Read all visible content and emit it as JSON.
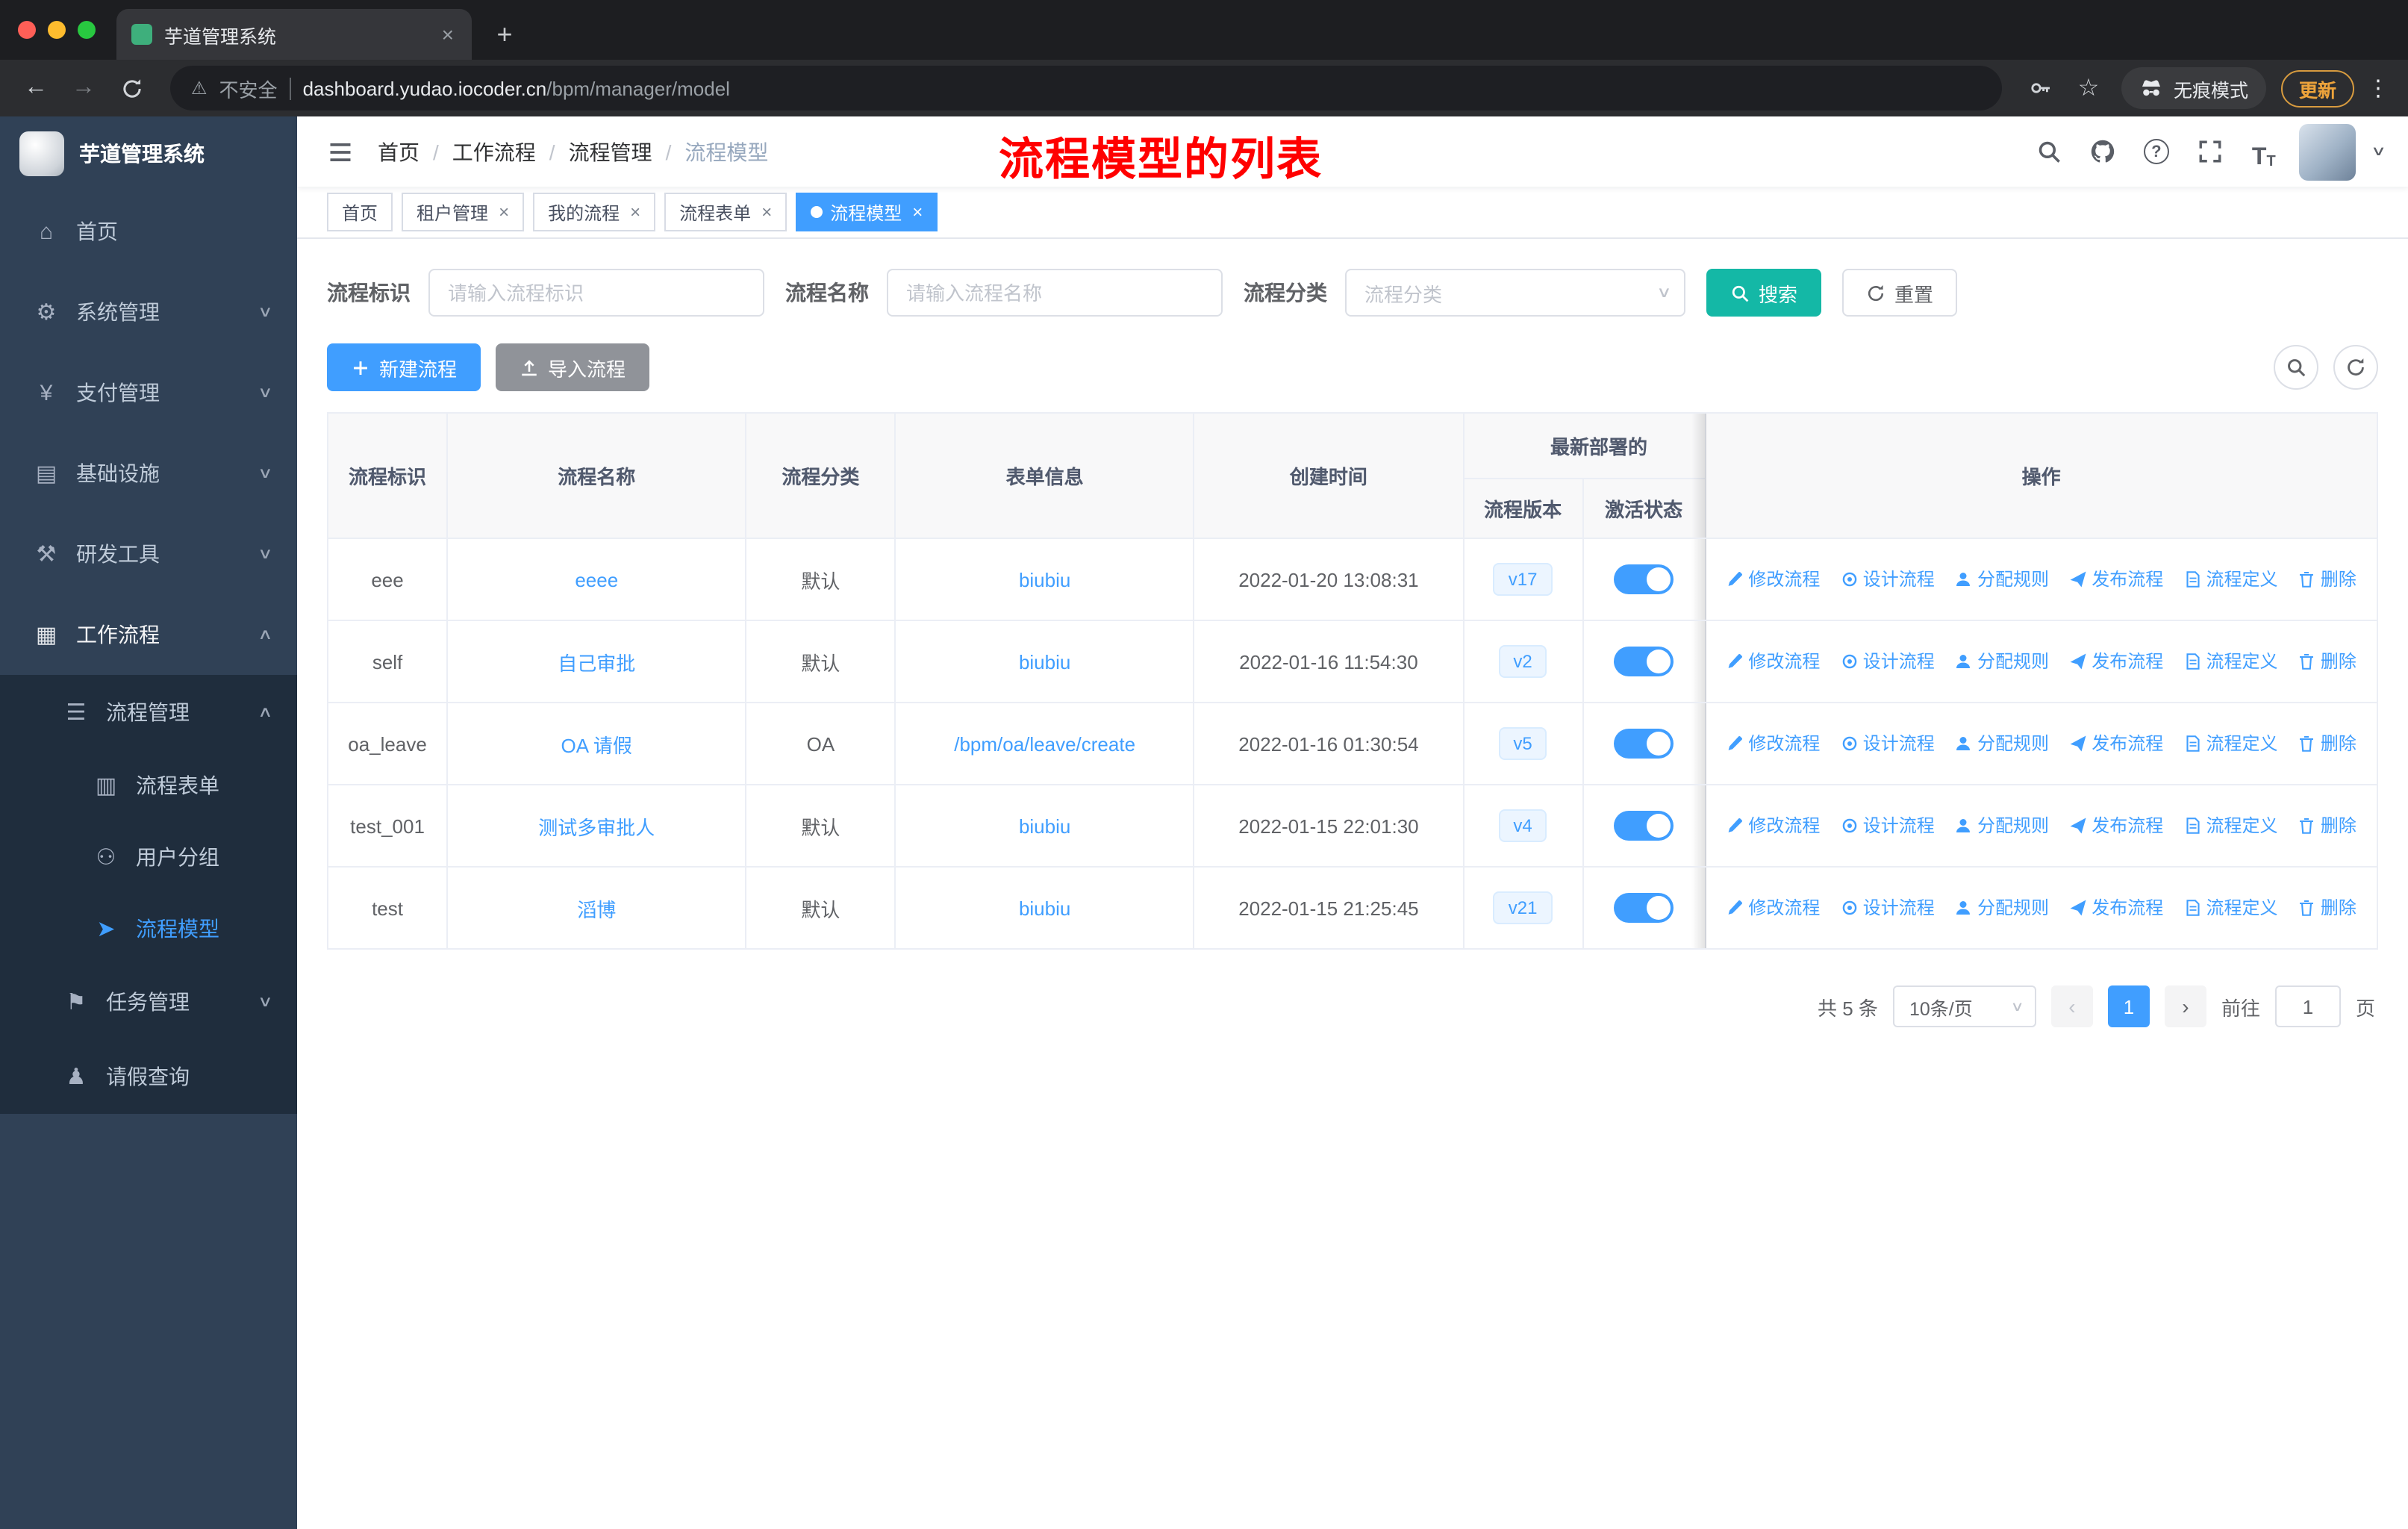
{
  "colors": {
    "accent": "#409eff",
    "search_button": "#14b8a6",
    "annotation_red": "#ff0000",
    "sidebar_bg": "#304156",
    "submenu_bg": "#1f2d3d",
    "active_toggle": "#409eff"
  },
  "browser": {
    "tab_title": "芋道管理系统",
    "security_label": "不安全",
    "url_domain": "dashboard.yudao.iocoder.cn",
    "url_path": "/bpm/manager/model",
    "incognito_label": "无痕模式",
    "update_label": "更新"
  },
  "sidebar": {
    "logo_title": "芋道管理系统",
    "items": [
      {
        "label": "首页"
      },
      {
        "label": "系统管理"
      },
      {
        "label": "支付管理"
      },
      {
        "label": "基础设施"
      },
      {
        "label": "研发工具"
      },
      {
        "label": "工作流程"
      },
      {
        "label": "流程管理"
      },
      {
        "label": "流程表单"
      },
      {
        "label": "用户分组"
      },
      {
        "label": "流程模型"
      },
      {
        "label": "任务管理"
      },
      {
        "label": "请假查询"
      }
    ]
  },
  "header": {
    "breadcrumb": [
      "首页",
      "工作流程",
      "流程管理",
      "流程模型"
    ],
    "annotation": "流程模型的列表"
  },
  "tags": [
    {
      "label": "首页"
    },
    {
      "label": "租户管理"
    },
    {
      "label": "我的流程"
    },
    {
      "label": "流程表单"
    },
    {
      "label": "流程模型"
    }
  ],
  "filters": {
    "key_label": "流程标识",
    "key_placeholder": "请输入流程标识",
    "name_label": "流程名称",
    "name_placeholder": "请输入流程名称",
    "category_label": "流程分类",
    "category_placeholder": "流程分类",
    "search_label": "搜索",
    "reset_label": "重置"
  },
  "toolbar": {
    "create_label": "新建流程",
    "import_label": "导入流程"
  },
  "table": {
    "headers": {
      "key": "流程标识",
      "name": "流程名称",
      "category": "流程分类",
      "form": "表单信息",
      "created": "创建时间",
      "deploy_group": "最新部署的",
      "version": "流程版本",
      "active": "激活状态",
      "actions": "操作"
    },
    "action_labels": [
      "修改流程",
      "设计流程",
      "分配规则",
      "发布流程",
      "流程定义",
      "删除"
    ],
    "rows": [
      {
        "key": "eee",
        "name": "eeee",
        "category": "默认",
        "form": "biubiu",
        "created": "2022-01-20 13:08:31",
        "version": "v17"
      },
      {
        "key": "self",
        "name": "自己审批",
        "category": "默认",
        "form": "biubiu",
        "created": "2022-01-16 11:54:30",
        "version": "v2"
      },
      {
        "key": "oa_leave",
        "name": "OA 请假",
        "category": "OA",
        "form": "/bpm/oa/leave/create",
        "created": "2022-01-16 01:30:54",
        "version": "v5"
      },
      {
        "key": "test_001",
        "name": "测试多审批人",
        "category": "默认",
        "form": "biubiu",
        "created": "2022-01-15 22:01:30",
        "version": "v4"
      },
      {
        "key": "test",
        "name": "滔博",
        "category": "默认",
        "form": "biubiu",
        "created": "2022-01-15 21:25:45",
        "version": "v21"
      }
    ]
  },
  "pagination": {
    "total": "共 5 条",
    "page_size": "10条/页",
    "current_page": "1",
    "goto_label": "前往",
    "goto_value": "1",
    "page_unit": "页"
  }
}
